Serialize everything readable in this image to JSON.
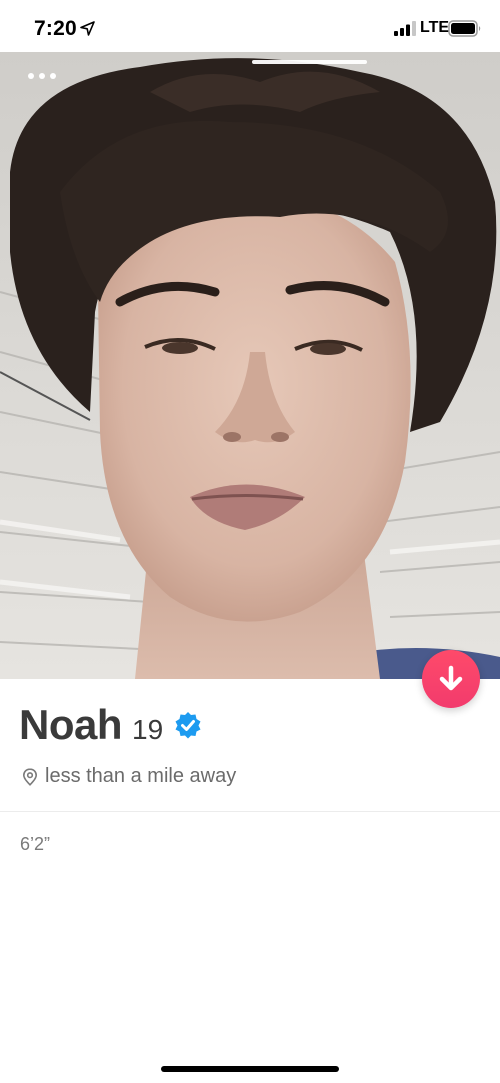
{
  "status_bar": {
    "time": "7:20",
    "network": "LTE",
    "icons": [
      "location-arrow-icon",
      "signal-icon",
      "battery-icon"
    ]
  },
  "photo": {
    "description_icon": "profile-photo",
    "photo_count_indicator": "1"
  },
  "profile": {
    "name": "Noah",
    "age": "19",
    "verified": true,
    "distance": "less than a mile away",
    "height": "6’2”"
  },
  "colors": {
    "accent": "#fd4e6a",
    "verified": "#1d9bf0",
    "text_primary": "#3a3a3a",
    "text_secondary": "#6b6b6b"
  }
}
